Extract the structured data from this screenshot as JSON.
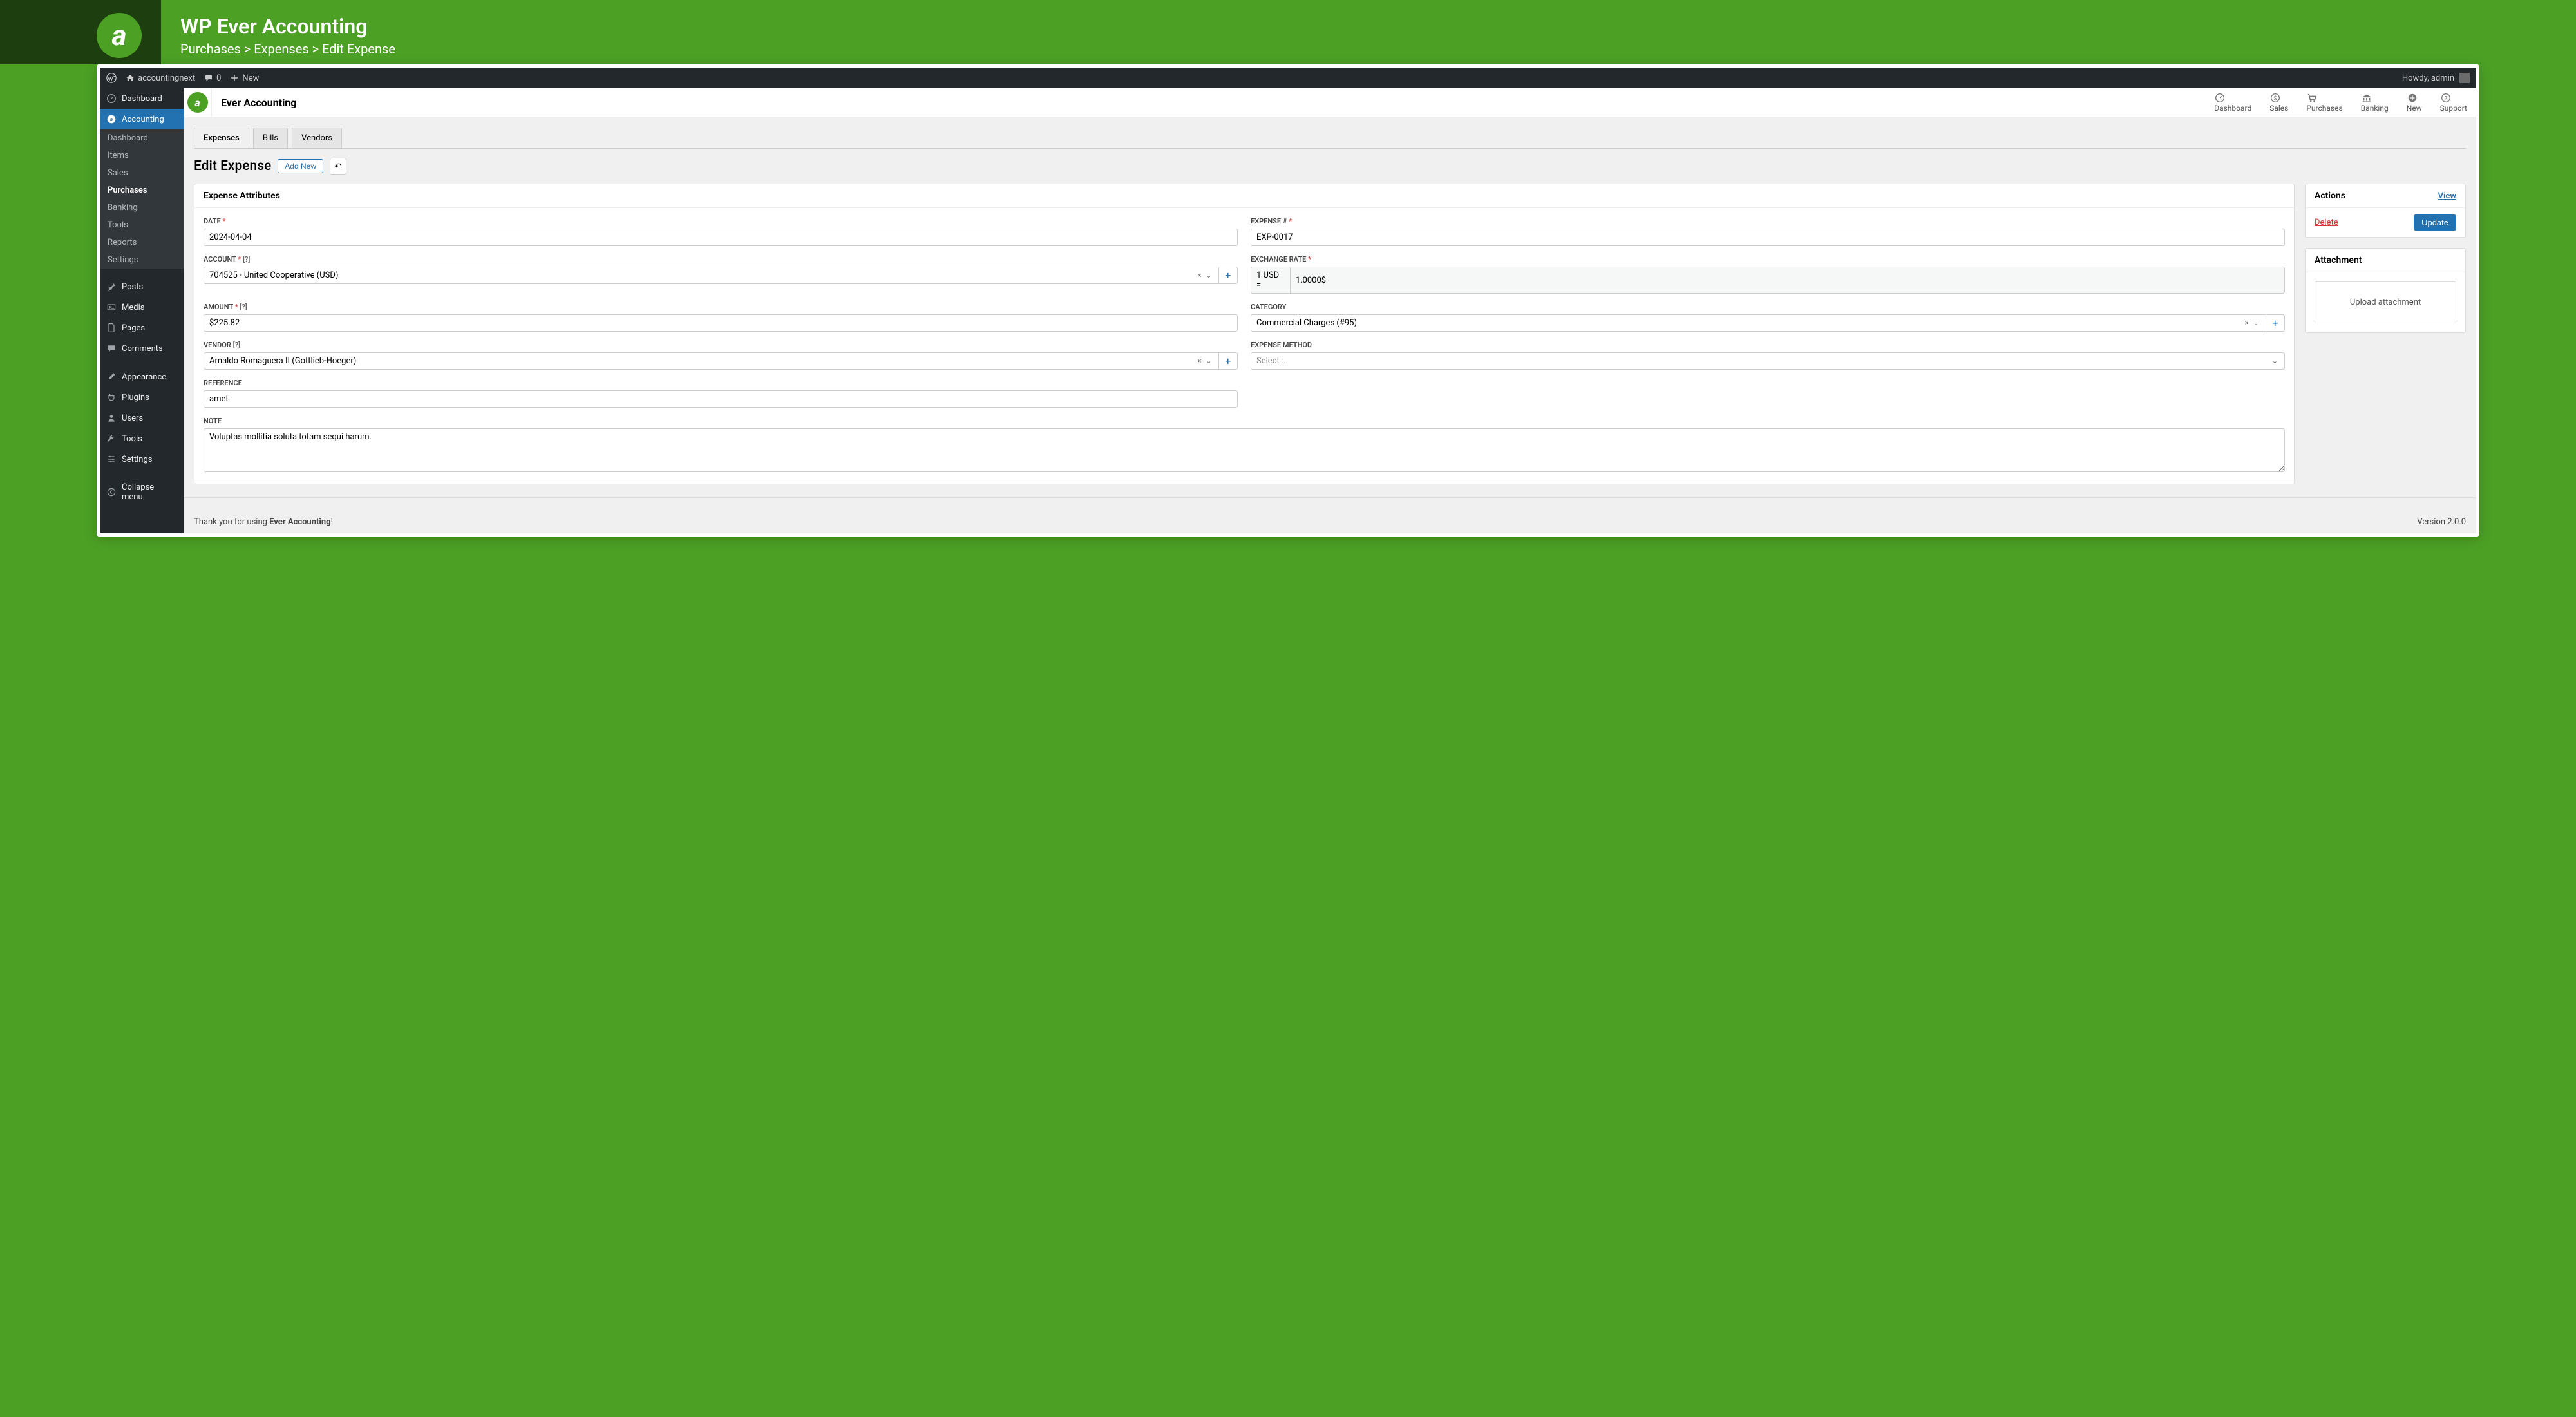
{
  "outer": {
    "title": "WP Ever Accounting",
    "breadcrumb": "Purchases > Expenses > Edit Expense",
    "logo_letter": "a"
  },
  "adminbar": {
    "site_name": "accountingnext",
    "comment_count": "0",
    "new_label": "New",
    "greeting": "Howdy, admin"
  },
  "wp_menu": {
    "dashboard": "Dashboard",
    "accounting": "Accounting",
    "submenu": {
      "dashboard": "Dashboard",
      "items": "Items",
      "sales": "Sales",
      "purchases": "Purchases",
      "banking": "Banking",
      "tools": "Tools",
      "reports": "Reports",
      "settings": "Settings"
    },
    "posts": "Posts",
    "media": "Media",
    "pages": "Pages",
    "comments": "Comments",
    "appearance": "Appearance",
    "plugins": "Plugins",
    "users": "Users",
    "tools": "Tools",
    "settings": "Settings",
    "collapse": "Collapse menu"
  },
  "plugin": {
    "title": "Ever Accounting",
    "logo_letter": "a",
    "nav": {
      "dashboard": "Dashboard",
      "sales": "Sales",
      "purchases": "Purchases",
      "banking": "Banking",
      "new": "New",
      "support": "Support"
    }
  },
  "tabs": {
    "expenses": "Expenses",
    "bills": "Bills",
    "vendors": "Vendors"
  },
  "page": {
    "title": "Edit Expense",
    "add_new": "Add New"
  },
  "panel": {
    "attributes": "Expense Attributes",
    "actions": "Actions",
    "attachment": "Attachment"
  },
  "labels": {
    "date": "DATE",
    "expense_no": "EXPENSE #",
    "account": "ACCOUNT",
    "exchange_rate": "EXCHANGE RATE",
    "amount": "AMOUNT",
    "category": "CATEGORY",
    "vendor": "VENDOR",
    "expense_method": "EXPENSE METHOD",
    "reference": "REFERENCE",
    "note": "NOTE",
    "help": "[?]"
  },
  "values": {
    "date": "2024-04-04",
    "expense_no": "EXP-0017",
    "account": "704525 - United Cooperative (USD)",
    "exchange_prefix": "1 USD =",
    "exchange_rate": "1.0000$",
    "amount": "$225.82",
    "category": "Commercial Charges (#95)",
    "vendor": "Arnaldo Romaguera II (Gottlieb-Hoeger)",
    "expense_method": "Select ...",
    "reference": "amet",
    "note": "Voluptas mollitia soluta totam sequi harum."
  },
  "actions": {
    "view": "View",
    "delete": "Delete",
    "update": "Update",
    "upload": "Upload attachment"
  },
  "footer": {
    "thank_prefix": "Thank you for using ",
    "thank_brand": "Ever Accounting",
    "thank_suffix": "!",
    "version": "Version 2.0.0"
  }
}
